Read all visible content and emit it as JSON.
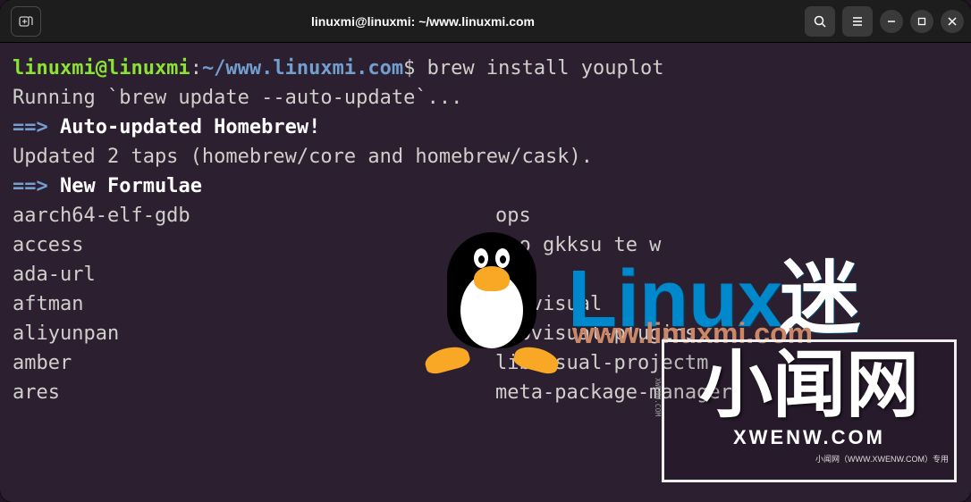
{
  "titlebar": {
    "title": "linuxmi@linuxmi: ~/www.linuxmi.com"
  },
  "prompt": {
    "user_host": "linuxmi@linuxmi",
    "colon": ":",
    "path": "~/www.linuxmi.com",
    "dollar": "$"
  },
  "command": "brew install youplot",
  "output": {
    "running": "Running `brew update --auto-update`...",
    "arrow1": "==>",
    "auto_updated": "Auto-updated Homebrew!",
    "updated_taps": "Updated 2 taps (homebrew/core and homebrew/cask).",
    "arrow2": "==>",
    "new_formulae": "New Formulae",
    "formulae": [
      {
        "col1": "aarch64-elf-gdb",
        "col2": "ops"
      },
      {
        "col1": "access",
        "col2": "geo  gkksu te  w"
      },
      {
        "col1": "ada-url",
        "col2": ""
      },
      {
        "col1": "aftman",
        "col2": "libvisual"
      },
      {
        "col1": "aliyunpan",
        "col2": "libvisual-plugins"
      },
      {
        "col1": "amber",
        "col2": "libvisual-projectm"
      },
      {
        "col1": "ares",
        "col2": "meta-package-manager"
      }
    ]
  },
  "watermarks": {
    "linux_text": "Linux",
    "linux_cn": "迷",
    "linux_url": "www.linuxmi.com",
    "xwen_cn": "小闻网",
    "xwen_en": "XWENW.COM",
    "xwen_small": "小闻网（WWW.XWENW.COM）专用",
    "xwen_vert": "XWENW.COM"
  }
}
